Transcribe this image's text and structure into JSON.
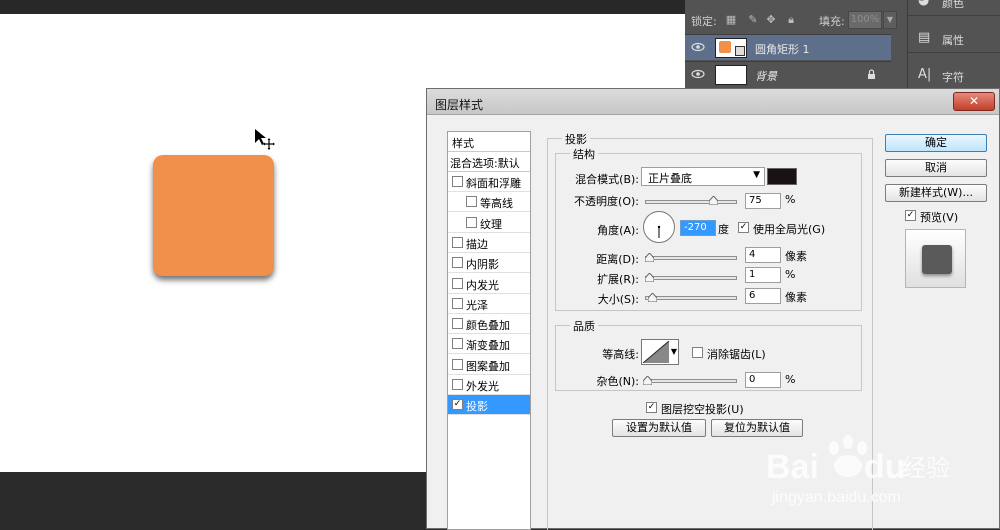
{
  "layers_panel": {
    "lock_label": "锁定:",
    "fill_label": "填充:",
    "fill_value": "100%",
    "layers": [
      {
        "name": "圆角矩形 1",
        "selected": true
      },
      {
        "name": "背景",
        "selected": false
      }
    ]
  },
  "side_panel": {
    "items": [
      {
        "label": "颜色",
        "icon": "palette-icon"
      },
      {
        "label": "属性",
        "icon": "properties-icon"
      },
      {
        "label": "字符",
        "icon": "character-icon"
      }
    ]
  },
  "canvas": {
    "shape_color": "#f0904a"
  },
  "dialog": {
    "title": "图层样式",
    "close_symbol": "✕",
    "styles_list": {
      "header": "样式",
      "blend_options": "混合选项:默认",
      "items": [
        {
          "label": "斜面和浮雕",
          "checked": false,
          "indent": 0
        },
        {
          "label": "等高线",
          "checked": false,
          "indent": 1
        },
        {
          "label": "纹理",
          "checked": false,
          "indent": 1
        },
        {
          "label": "描边",
          "checked": false,
          "indent": 0
        },
        {
          "label": "内阴影",
          "checked": false,
          "indent": 0
        },
        {
          "label": "内发光",
          "checked": false,
          "indent": 0
        },
        {
          "label": "光泽",
          "checked": false,
          "indent": 0
        },
        {
          "label": "颜色叠加",
          "checked": false,
          "indent": 0
        },
        {
          "label": "渐变叠加",
          "checked": false,
          "indent": 0
        },
        {
          "label": "图案叠加",
          "checked": false,
          "indent": 0
        },
        {
          "label": "外发光",
          "checked": false,
          "indent": 0
        },
        {
          "label": "投影",
          "checked": true,
          "indent": 0,
          "selected": true
        }
      ]
    },
    "drop_shadow": {
      "section_title": "投影",
      "structure_title": "结构",
      "blend_mode_label": "混合模式(B):",
      "blend_mode_value": "正片叠底",
      "shadow_color": "#1a1212",
      "opacity_label": "不透明度(O):",
      "opacity_value": "75",
      "opacity_unit": "%",
      "angle_label": "角度(A):",
      "angle_value": "-270",
      "angle_unit": "度",
      "global_light_label": "使用全局光(G)",
      "global_light_checked": true,
      "distance_label": "距离(D):",
      "distance_value": "4",
      "distance_unit": "像素",
      "spread_label": "扩展(R):",
      "spread_value": "1",
      "spread_unit": "%",
      "size_label": "大小(S):",
      "size_value": "6",
      "size_unit": "像素",
      "quality_title": "品质",
      "contour_label": "等高线:",
      "antialias_label": "消除锯齿(L)",
      "antialias_checked": false,
      "noise_label": "杂色(N):",
      "noise_value": "0",
      "noise_unit": "%",
      "knockout_label": "图层挖空投影(U)",
      "knockout_checked": true,
      "make_default_label": "设置为默认值",
      "reset_default_label": "复位为默认值"
    },
    "buttons": {
      "ok": "确定",
      "cancel": "取消",
      "new_style": "新建样式(W)...",
      "preview_label": "预览(V)",
      "preview_checked": true
    }
  },
  "watermark": {
    "brand": "Bai",
    "brand2": "du",
    "cn": "经验",
    "url": "jingyan.baidu.com"
  }
}
